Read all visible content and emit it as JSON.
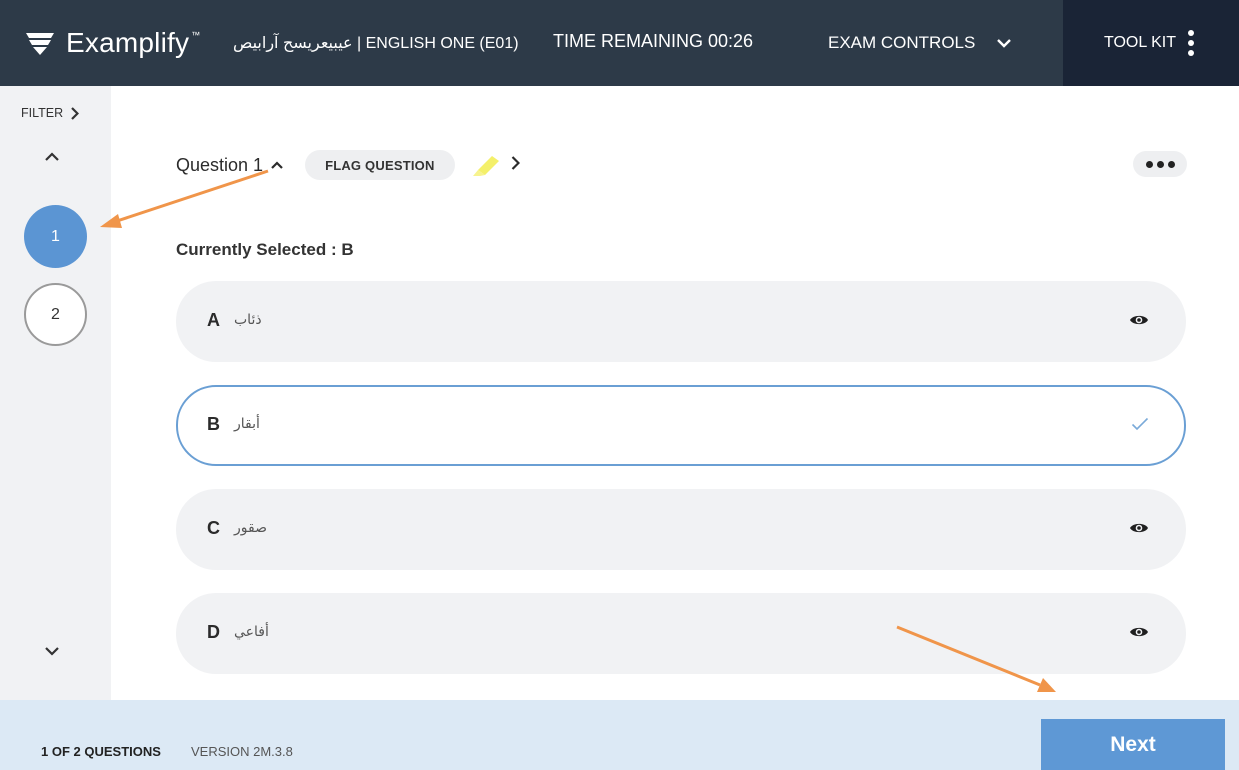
{
  "header": {
    "logo_text": "Examplify",
    "logo_tm": "™",
    "exam_title": "عيبيعريسح آرابيص | ENGLISH ONE (E01)",
    "time_label": "TIME REMAINING 00:26",
    "exam_controls_label": "EXAM CONTROLS",
    "toolkit_label": "TOOL KIT"
  },
  "sidebar": {
    "filter_label": "FILTER",
    "questions": [
      {
        "number": "1",
        "active": true
      },
      {
        "number": "2",
        "active": false
      }
    ]
  },
  "question": {
    "title": "Question 1",
    "flag_label": "FLAG QUESTION",
    "currently_selected": "Currently Selected : B",
    "options": [
      {
        "letter": "A",
        "text": "ذئاب",
        "icon": "eye-icon",
        "selected": false
      },
      {
        "letter": "B",
        "text": "أبقار",
        "icon": "check-icon",
        "selected": true
      },
      {
        "letter": "C",
        "text": "صقور",
        "icon": "eye-icon",
        "selected": false
      },
      {
        "letter": "D",
        "text": "أفاعي",
        "icon": "eye-icon",
        "selected": false
      }
    ]
  },
  "footer": {
    "count": "1 OF 2 QUESTIONS",
    "version": "VERSION 2M.3.8",
    "next_label": "Next"
  },
  "colors": {
    "topbar": "#2d3a48",
    "toolkit": "#1a2436",
    "accent": "#5b95d3",
    "highlighter": "#f4f06a",
    "annotation_arrow": "#f0954a",
    "footer": "#dce9f5"
  }
}
